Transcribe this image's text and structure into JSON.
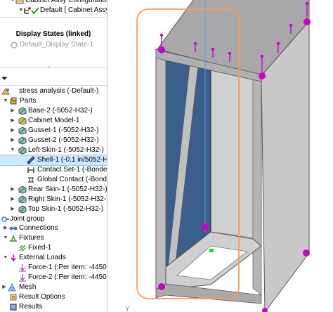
{
  "tree_top": {
    "config_label": "Cabinet Assy Configuration(s",
    "default_label": "Default [ Cabinet Assy"
  },
  "display_states": {
    "header": "Display States (linked)",
    "item": "Default_Display State-1"
  },
  "study": {
    "name": "stress analysis (-Default-)",
    "parts_label": "Parts",
    "parts": [
      {
        "label": "Base-2 (-5052-H32-)"
      },
      {
        "label": "Cabinet Model-1"
      },
      {
        "label": "Gusset-1 (-5052-H32-)"
      },
      {
        "label": "Gusset-2 (-5052-H32-)"
      },
      {
        "label": "Left Skin-1 (-5052-H32-)"
      }
    ],
    "left_skin_children": [
      {
        "label": "Shell-1 (-0.1 in/5052-H"
      },
      {
        "label": "Contact Set-1 (-Bonde"
      },
      {
        "label": "Global Contact (-Bonde"
      }
    ],
    "more_parts": [
      {
        "label": "Rear Skin-1 (-5052-H32-)"
      },
      {
        "label": "Right Skin-1 (-5052-H32-)"
      },
      {
        "label": "Top Skin-1 (-5052-H32-)"
      }
    ],
    "joint_group": "Joint group",
    "connections": "Connections",
    "fixtures": "Fixtures",
    "fixed": "Fixed-1",
    "external_loads": "External Loads",
    "force1": "Force-1 (:Per item: -4450",
    "force2": "Force-2 (:Per item: -4450",
    "mesh": "Mesh",
    "result_options": "Result Options",
    "results": "Results"
  },
  "colors": {
    "selection": "#cde8ff",
    "load_arrow": "#cc00cc",
    "blue_panel": "#3a5f8c",
    "highlight_box": "#ff9955"
  }
}
